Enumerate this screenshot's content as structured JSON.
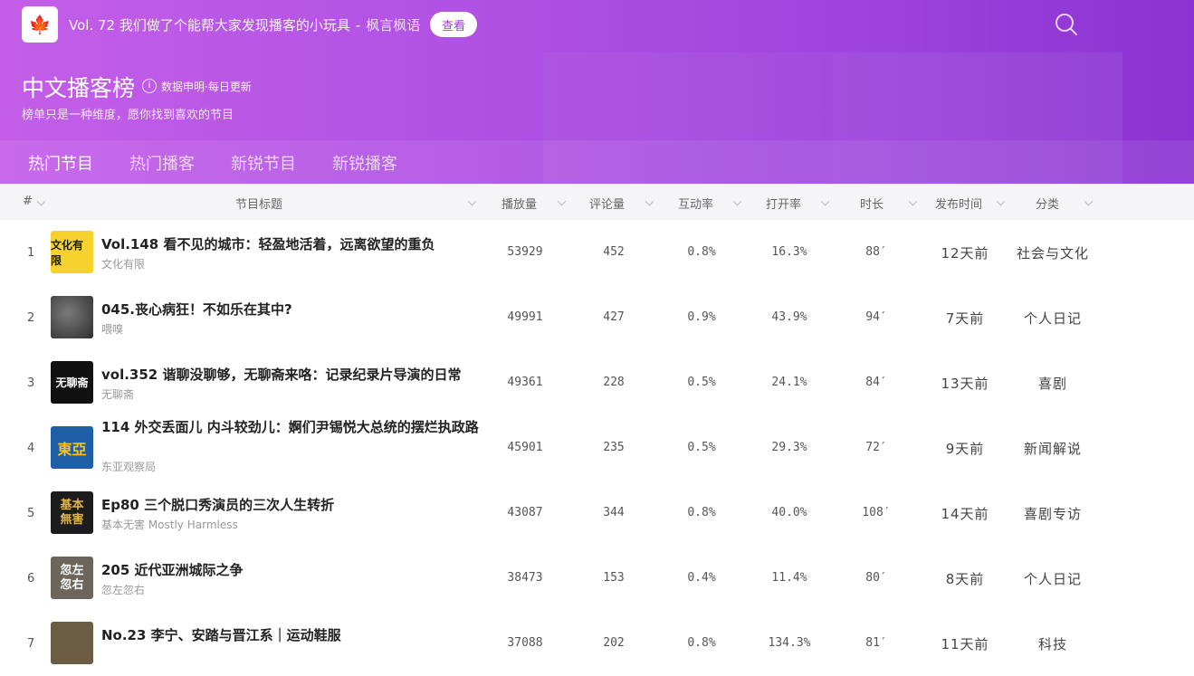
{
  "banner": {
    "text": "Vol. 72 我们做了个能帮大家发现播客的小玩具",
    "separator": "-",
    "source": "枫言枫语",
    "button": "查看"
  },
  "header": {
    "title": "中文播客榜",
    "info_icon": "i",
    "data_note": "数据申明·每日更新",
    "subtitle": "榜单只是一种维度，愿你找到喜欢的节目"
  },
  "tabs": [
    "热门节目",
    "热门播客",
    "新锐节目",
    "新锐播客"
  ],
  "table": {
    "columns": {
      "rank": "#",
      "title": "节目标题",
      "plays": "播放量",
      "comments": "评论量",
      "interaction": "互动率",
      "open_rate": "打开率",
      "duration": "时长",
      "published": "发布时间",
      "category": "分类"
    },
    "rows": [
      {
        "rank": "1",
        "title": "Vol.148 看不见的城市：轻盈地活着，远离欲望的重负",
        "podcast": "文化有限",
        "plays": "53929",
        "comments": "452",
        "interaction": "0.8%",
        "open_rate": "16.3%",
        "duration": "88′",
        "published": "12天前",
        "category": "社会与文化",
        "cover_text": "文化有限",
        "cover_bg": "#f5d22e",
        "cover_fg": "#1a1a1a"
      },
      {
        "rank": "2",
        "title": "045.丧心病狂！不如乐在其中?",
        "podcast": "喂嗅",
        "plays": "49991",
        "comments": "427",
        "interaction": "0.9%",
        "open_rate": "43.9%",
        "duration": "94′",
        "published": "7天前",
        "category": "个人日记",
        "cover_text": "",
        "cover_bg": "#4a4a4a",
        "cover_fg": "#ffffff"
      },
      {
        "rank": "3",
        "title": "vol.352 谐聊没聊够，无聊斋来咯：记录纪录片导演的日常",
        "podcast": "无聊斋",
        "plays": "49361",
        "comments": "228",
        "interaction": "0.5%",
        "open_rate": "24.1%",
        "duration": "84′",
        "published": "13天前",
        "category": "喜剧",
        "cover_text": "无聊斋",
        "cover_bg": "#111111",
        "cover_fg": "#ffffff"
      },
      {
        "rank": "4",
        "title": "114 外交丢面儿 内斗较劲儿：婀们尹锡悦大总统的摆烂执政路",
        "podcast": "东亚观察局",
        "plays": "45901",
        "comments": "235",
        "interaction": "0.5%",
        "open_rate": "29.3%",
        "duration": "72′",
        "published": "9天前",
        "category": "新闻解说",
        "cover_text": "東亞",
        "cover_bg": "#1f5fa8",
        "cover_fg": "#f5c518"
      },
      {
        "rank": "5",
        "title": "Ep80 三个脱口秀演员的三次人生转折",
        "podcast": "基本无害 Mostly Harmless",
        "plays": "43087",
        "comments": "344",
        "interaction": "0.8%",
        "open_rate": "40.0%",
        "duration": "108′",
        "published": "14天前",
        "category": "喜剧专访",
        "cover_text": "基本無害",
        "cover_bg": "#1c1c1c",
        "cover_fg": "#e0b44a"
      },
      {
        "rank": "6",
        "title": "205 近代亚洲城际之争",
        "podcast": "忽左忽右",
        "plays": "38473",
        "comments": "153",
        "interaction": "0.4%",
        "open_rate": "11.4%",
        "duration": "80′",
        "published": "8天前",
        "category": "个人日记",
        "cover_text": "忽左忽右",
        "cover_bg": "#6b655c",
        "cover_fg": "#ffffff"
      },
      {
        "rank": "7",
        "title": "No.23 李宁、安踏与晋江系｜运动鞋服",
        "podcast": "",
        "plays": "37088",
        "comments": "202",
        "interaction": "0.8%",
        "open_rate": "134.3%",
        "duration": "81′",
        "published": "11天前",
        "category": "科技",
        "cover_text": "",
        "cover_bg": "#6d5c44",
        "cover_fg": "#ffffff"
      }
    ]
  }
}
